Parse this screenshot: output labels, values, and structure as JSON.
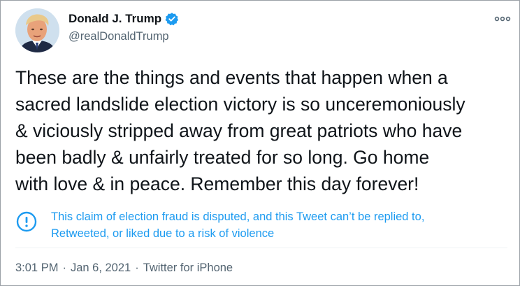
{
  "user": {
    "display_name": "Donald J. Trump",
    "handle": "@realDonaldTrump",
    "verified": true
  },
  "tweet": {
    "text_lines": [
      "These are the things and events that happen when a",
      "sacred landslide election victory is so unceremoniously",
      "& viciously stripped away from great patriots who have",
      "been badly & unfairly treated for so long. Go home",
      "with love & in peace. Remember this day forever!"
    ]
  },
  "notice": {
    "icon": "exclamation-circle-icon",
    "lines": [
      "This claim of election fraud is disputed, and this Tweet can’t be replied to,",
      "Retweeted, or liked due to a risk of violence"
    ]
  },
  "meta": {
    "time": "3:01 PM",
    "separator": "·",
    "date": "Jan 6, 2021",
    "source": "Twitter for iPhone"
  },
  "colors": {
    "accent": "#1d9bf0",
    "text": "#0f1419",
    "secondary": "#536471"
  }
}
